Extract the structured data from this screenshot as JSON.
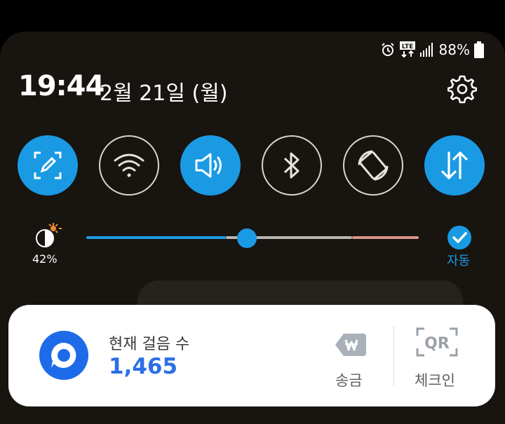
{
  "status_bar": {
    "icons": [
      "alarm-icon",
      "lte-icon",
      "signal-icon",
      "battery-icon"
    ],
    "lte_label": "LTE",
    "battery": "88%"
  },
  "header": {
    "time": "19:44",
    "date": "2월 21일 (월)"
  },
  "toggles": [
    {
      "name": "screen-capture-toggle",
      "icon": "edit-capture-icon",
      "on": true
    },
    {
      "name": "wifi-toggle",
      "icon": "wifi-icon",
      "on": false
    },
    {
      "name": "sound-toggle",
      "icon": "speaker-icon",
      "on": true
    },
    {
      "name": "bluetooth-toggle",
      "icon": "bluetooth-icon",
      "on": false
    },
    {
      "name": "auto-rotate-toggle",
      "icon": "rotate-icon",
      "on": false
    },
    {
      "name": "mobile-data-toggle",
      "icon": "data-transfer-icon",
      "on": true
    }
  ],
  "brightness": {
    "percent": "42%",
    "level": 0.42,
    "auto_label": "자동"
  },
  "widget": {
    "steps_label": "현재 걸음 수",
    "steps_value": "1,465",
    "send_label": "송금",
    "checkin_label": "체크인",
    "qr_text": "QR"
  },
  "colors": {
    "accent": "#1a9ae3",
    "panel_bg": "#18140f",
    "brand_blue": "#1d6be8",
    "steps_blue": "#2b6fe4"
  }
}
